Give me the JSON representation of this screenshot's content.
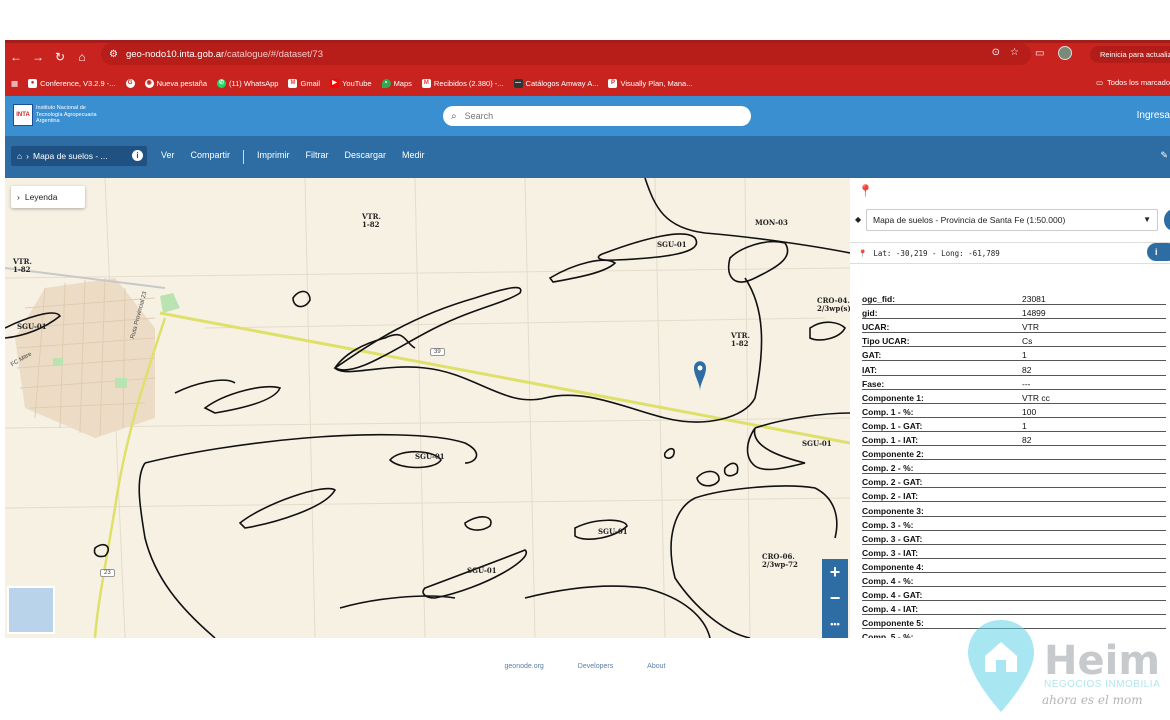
{
  "browser": {
    "url_host": "geo-nodo10.inta.gob.ar",
    "url_path": "/catalogue/#/dataset/73",
    "update_label": "Reinicia para actualizar",
    "bookmarks": [
      {
        "label": "Conference, V3.2.9 -...",
        "icon": "globe-icon",
        "color": "#ffffff"
      },
      {
        "label": "",
        "icon": "chrome-icon",
        "color": "#ffffff"
      },
      {
        "label": "Nueva pestaña",
        "icon": "chrome-icon",
        "color": "#ffffff"
      },
      {
        "label": "(11) WhatsApp",
        "icon": "whatsapp-icon",
        "color": "#25d366"
      },
      {
        "label": "Gmail",
        "icon": "gmail-icon",
        "color": "#ea4335"
      },
      {
        "label": "YouTube",
        "icon": "youtube-icon",
        "color": "#ff0000"
      },
      {
        "label": "Maps",
        "icon": "maps-icon",
        "color": "#34a853"
      },
      {
        "label": "Recibidos (2.380) -...",
        "icon": "gmail-icon",
        "color": "#ea4335"
      },
      {
        "label": "Catálogos Amway A...",
        "icon": "amway-icon",
        "color": "#333333"
      },
      {
        "label": "Visually Plan, Mana...",
        "icon": "p-icon",
        "color": "#ffffff"
      }
    ],
    "all_bookmarks": "Todos los marcado"
  },
  "site": {
    "logo_abbr": "INTA",
    "logo_lines": [
      "Instituto Nacional de",
      "Tecnología Agropecuaria",
      "Argentina"
    ],
    "search_placeholder": "Search",
    "login_label": "Ingresa"
  },
  "toolbar": {
    "breadcrumb": "Mapa de suelos - ...",
    "info_label": "i",
    "items": [
      "Ver",
      "Compartir",
      "Imprimir",
      "Filtrar",
      "Descargar",
      "Medir"
    ]
  },
  "map": {
    "legend_label": "Leyenda",
    "labels": [
      {
        "text": "VTR.\n1-82",
        "name": "map-label-vtr-1"
      },
      {
        "text": "VTR.\n1-82",
        "name": "map-label-vtr-2"
      },
      {
        "text": "VTR.\n1-82",
        "name": "map-label-vtr-3"
      },
      {
        "text": "SGU-01",
        "name": "map-label-sgu-1"
      },
      {
        "text": "SGU-01",
        "name": "map-label-sgu-2"
      },
      {
        "text": "SGU-01",
        "name": "map-label-sgu-3"
      },
      {
        "text": "SGU-01",
        "name": "map-label-sgu-4"
      },
      {
        "text": "SGU-01",
        "name": "map-label-sgu-5"
      },
      {
        "text": "SGU-01",
        "name": "map-label-sgu-6"
      },
      {
        "text": "MON-03",
        "name": "map-label-mon"
      },
      {
        "text": "CRO-04.\n2/3wp(s)",
        "name": "map-label-cro-04"
      },
      {
        "text": "CRO-06.\n2/3wp-72",
        "name": "map-label-cro-06"
      }
    ],
    "road_39": "39",
    "road_23": "23",
    "road_name": "Ruta Provincial 23",
    "rail_name": "FC Mitre",
    "zoom_in": "+",
    "zoom_out": "−",
    "more": "•••"
  },
  "panel": {
    "layer": "Mapa de suelos - Provincia de Santa Fe (1:50.000)",
    "coordinates": "Lat: -30,219 - Long: -61,789",
    "info_label": "i",
    "attributes": [
      {
        "k": "ogc_fid:",
        "v": "23081"
      },
      {
        "k": "gid:",
        "v": "14899"
      },
      {
        "k": "UCAR:",
        "v": "VTR"
      },
      {
        "k": "Tipo UCAR:",
        "v": "Cs"
      },
      {
        "k": "GAT:",
        "v": "1"
      },
      {
        "k": "IAT:",
        "v": "82"
      },
      {
        "k": "Fase:",
        "v": "---"
      },
      {
        "k": "Componente 1:",
        "v": "VTR cc"
      },
      {
        "k": "Comp. 1 - %:",
        "v": "100"
      },
      {
        "k": "Comp. 1 - GAT:",
        "v": "1"
      },
      {
        "k": "Comp. 1 - IAT:",
        "v": "82"
      },
      {
        "k": "Componente 2:",
        "v": ""
      },
      {
        "k": "Comp. 2 - %:",
        "v": ""
      },
      {
        "k": "Comp. 2 - GAT:",
        "v": ""
      },
      {
        "k": "Comp. 2 - IAT:",
        "v": ""
      },
      {
        "k": "Componente 3:",
        "v": ""
      },
      {
        "k": "Comp. 3 - %:",
        "v": ""
      },
      {
        "k": "Comp. 3 - GAT:",
        "v": ""
      },
      {
        "k": "Comp. 3 - IAT:",
        "v": ""
      },
      {
        "k": "Componente 4:",
        "v": ""
      },
      {
        "k": "Comp. 4 - %:",
        "v": ""
      },
      {
        "k": "Comp. 4 - GAT:",
        "v": ""
      },
      {
        "k": "Comp. 4 - IAT:",
        "v": ""
      },
      {
        "k": "Componente 5:",
        "v": ""
      },
      {
        "k": "Comp. 5 - %:",
        "v": ""
      }
    ]
  },
  "footer": {
    "links": [
      "geonode.org",
      "Developers",
      "About"
    ]
  },
  "watermark": {
    "title": "Heim",
    "subtitle": "NEGOCIOS INMOBILIA",
    "tagline": "ahora es el mom"
  },
  "colors": {
    "chrome": "#c8231f",
    "header": "#3a8fd1",
    "toolbar": "#2e6da4",
    "map_bg": "#f7f1e4",
    "accent": "#2e6da4"
  }
}
